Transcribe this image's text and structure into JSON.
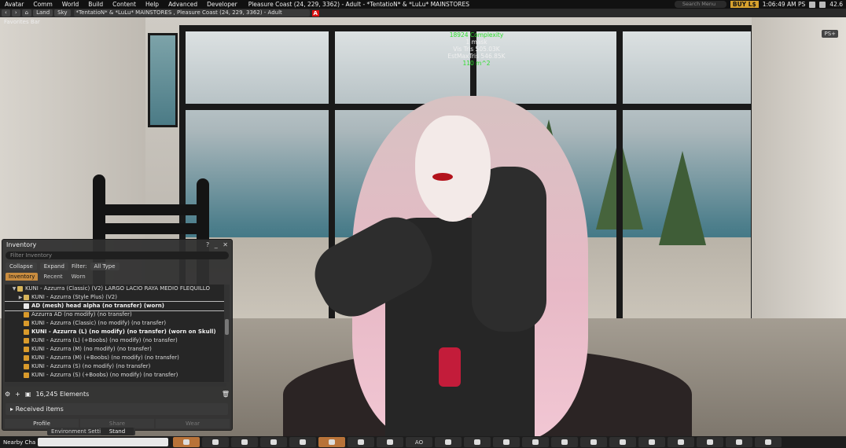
{
  "menubar": {
    "items": [
      "Avatar",
      "Comm",
      "World",
      "Build",
      "Content",
      "Help",
      "Advanced",
      "Developer"
    ],
    "location": "Pleasure Coast (24, 229, 3362) - Adult - *TentatioN* & *LuLu* MAINSTORES",
    "search_placeholder": "Search Menu",
    "buy_label": "BUY L$",
    "time": "1:06:49 AM PS",
    "fps": "42.6"
  },
  "navbar": {
    "home_label": "⌂",
    "land_label": "Land",
    "sky_label": "Sky",
    "location": "*TentatioN* & *LuLu* MAINSTORES , Pleasure Coast (24, 229, 3362) - Adult",
    "adult_badge": "A",
    "favorites": "Favorites Bar"
  },
  "stats": {
    "complexity": "18924 Complexity",
    "mask": "1 mask",
    "vis_tris": "Vis Tris 505.03K",
    "est_max_tris": "EstMaxTris 546.85K",
    "area": "110 m^2"
  },
  "ps_label": "PS+",
  "inventory": {
    "title": "Inventory",
    "ctrl_help": "?",
    "ctrl_min": "_",
    "ctrl_close": "✕",
    "filter_placeholder": "Filter Inventory",
    "collapse_label": "Collapse",
    "expand_label": "Expand",
    "filter_label": "Filter:",
    "filter_value": "All Type",
    "tabs": [
      "Inventory",
      "Recent",
      "Worn"
    ],
    "items": [
      {
        "text": "KUNI - Azzurra (Classic) (V2) LARGO LACIO RAYA MEDIO FLEQUILLO",
        "icon": "folder-open-icon",
        "indent": 1
      },
      {
        "text": "KUNI - Azzurra (Style Plus) (V2)",
        "icon": "folder-icon",
        "indent": 2
      },
      {
        "text": "AD (mesh) head alpha (no transfer) (worn)",
        "icon": "shirt-icon",
        "indent": 2,
        "bold": true,
        "selected": true
      },
      {
        "text": "Azzurra AD (no modify) (no transfer)",
        "icon": "object-icon",
        "indent": 2
      },
      {
        "text": "KUNI - Azzurra (Classic) (no modify) (no transfer)",
        "icon": "object-icon",
        "indent": 2
      },
      {
        "text": "KUNI - Azzurra (L) (no modify) (no transfer) (worn on Skull)",
        "icon": "object-icon",
        "indent": 2,
        "bold": true
      },
      {
        "text": "KUNI - Azzurra (L) (+Boobs) (no modify) (no transfer)",
        "icon": "object-icon",
        "indent": 2
      },
      {
        "text": "KUNI - Azzurra (M) (no modify) (no transfer)",
        "icon": "object-icon",
        "indent": 2
      },
      {
        "text": "KUNI - Azzurra (M) (+Boobs) (no modify) (no transfer)",
        "icon": "object-icon",
        "indent": 2
      },
      {
        "text": "KUNI - Azzurra (S) (no modify) (no transfer)",
        "icon": "object-icon",
        "indent": 2
      },
      {
        "text": "KUNI - Azzurra (S) (+Boobs) (no modify) (no transfer)",
        "icon": "object-icon",
        "indent": 2
      }
    ],
    "element_count": "16,245 Elements",
    "received_items": "Received items",
    "buttons": [
      "Profile",
      "Share",
      "Wear"
    ]
  },
  "env_settings": "Environment Settings",
  "stand_label": "Stand",
  "toolbar": {
    "chat_label": "Nearby Cha",
    "ao_label": "AO"
  },
  "colors": {
    "accent": "#c98c3f",
    "buy_bg": "#d7a12e",
    "stat_green": "#2fdf2f",
    "adult_red": "#dd1111"
  }
}
